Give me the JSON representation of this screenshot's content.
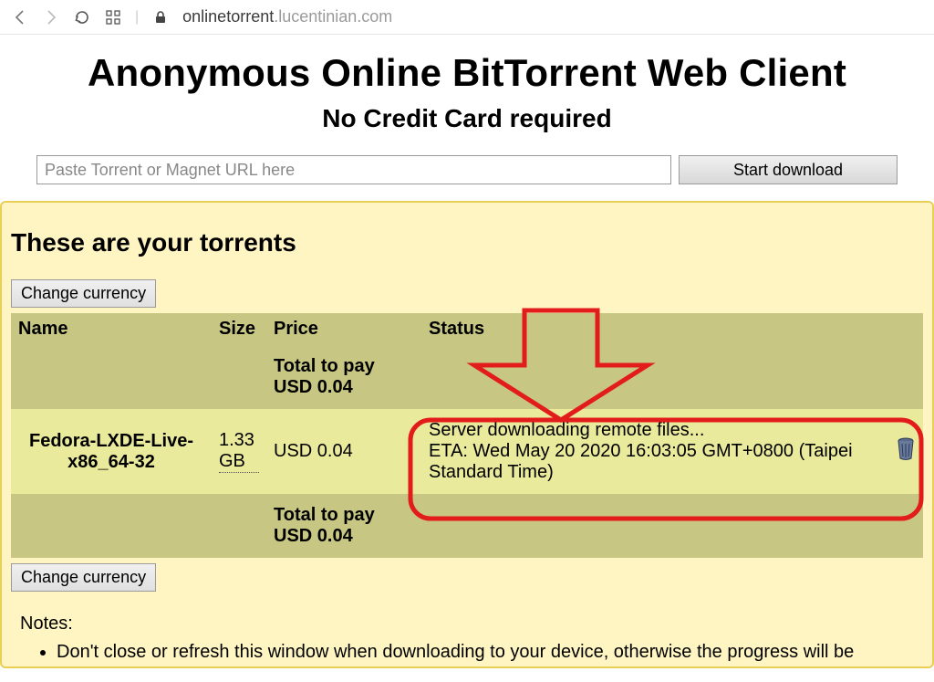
{
  "browser": {
    "url_sub": "onlinetorrent",
    "url_main": ".lucentinian.com"
  },
  "page": {
    "title": "Anonymous Online BitTorrent Web Client",
    "subtitle": "No Credit Card required"
  },
  "search": {
    "placeholder": "Paste Torrent or Magnet URL here",
    "button": "Start download"
  },
  "panel": {
    "heading": "These are your torrents",
    "change_currency": "Change currency",
    "columns": {
      "name": "Name",
      "size": "Size",
      "price": "Price",
      "status": "Status"
    },
    "total_label": "Total to pay",
    "total_value_top": "USD 0.04",
    "total_value_bottom": "USD 0.04"
  },
  "torrent": {
    "name": "Fedora-LXDE-Live-x86_64-32",
    "size": "1.33 GB",
    "price": "USD 0.04",
    "status_line1": "Server downloading remote files...",
    "status_line2": "ETA: Wed May 20 2020 16:03:05 GMT+0800 (Taipei Standard Time)"
  },
  "notes": {
    "heading": "Notes:",
    "item1": "Don't close or refresh this window when downloading to your device, otherwise the progress will be"
  }
}
